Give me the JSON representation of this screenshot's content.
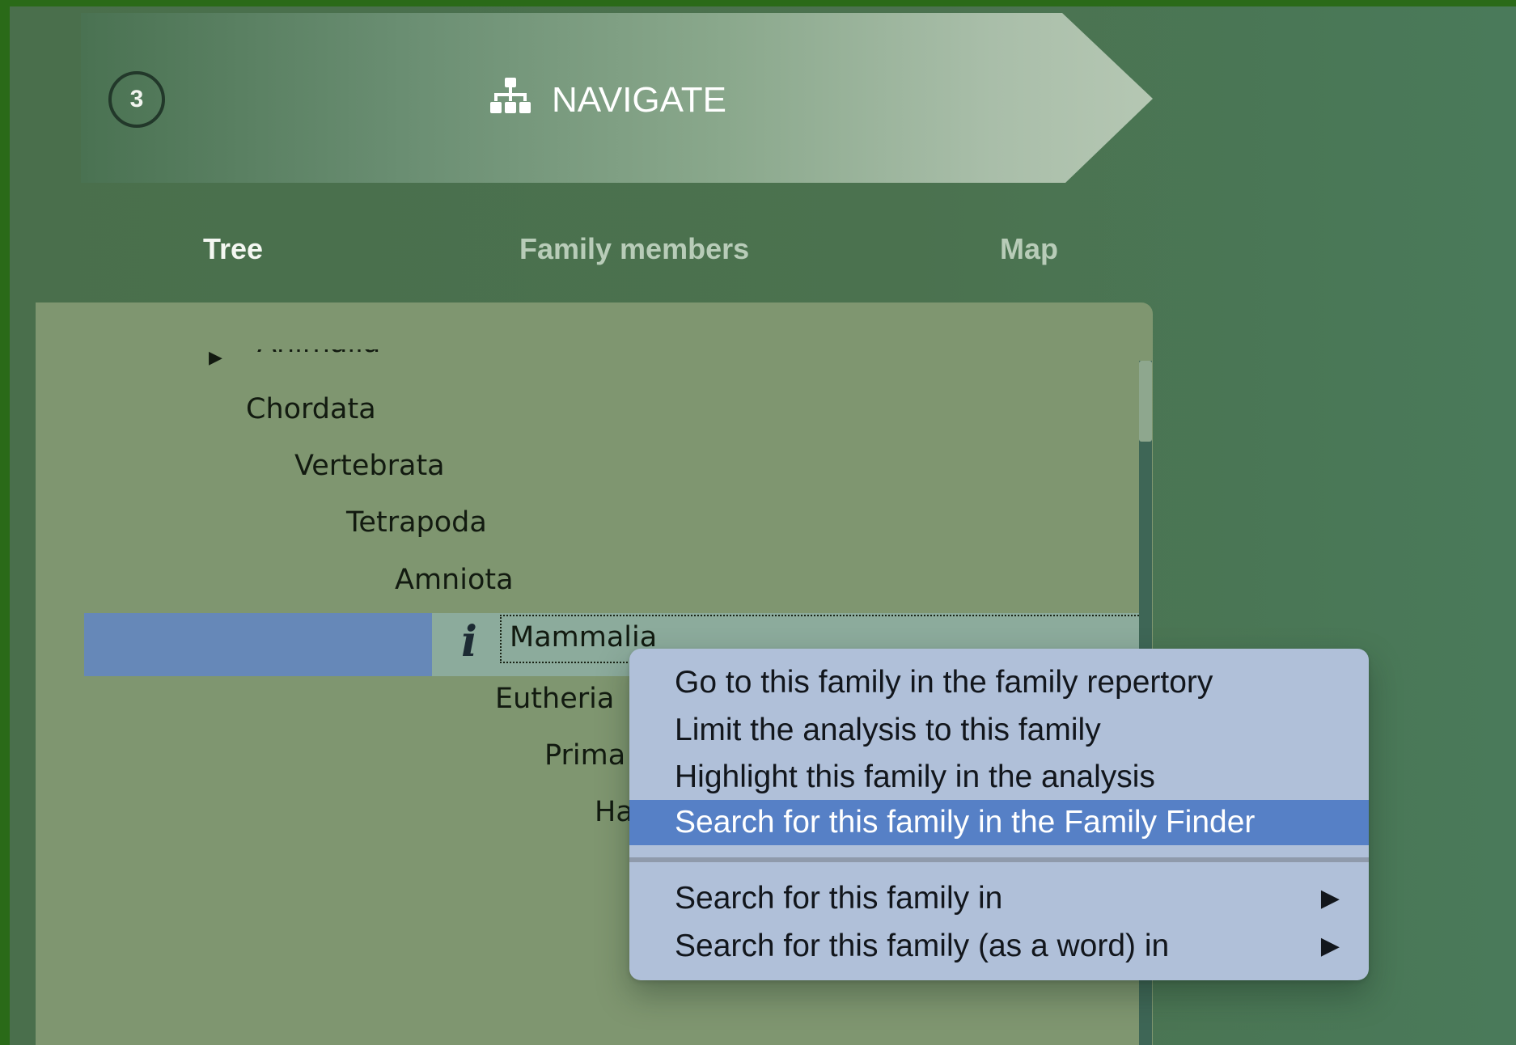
{
  "header": {
    "step_number": "3",
    "title": "NAVIGATE",
    "icon": "sitemap-icon"
  },
  "tabs": [
    {
      "label": "Tree",
      "active": true
    },
    {
      "label": "Family members",
      "active": false
    },
    {
      "label": "Map",
      "active": false
    }
  ],
  "tree": {
    "partial_item": "Animalia",
    "items": [
      {
        "label": "Chordata"
      },
      {
        "label": "Vertebrata"
      },
      {
        "label": "Tetrapoda"
      },
      {
        "label": "Amniota"
      },
      {
        "label": "Mammalia"
      },
      {
        "label": "Eutheria"
      },
      {
        "label": "Prima"
      },
      {
        "label": "Ha"
      }
    ],
    "info_glyph": "i"
  },
  "context_menu": {
    "items": [
      {
        "label": "Go to this family in the family repertory"
      },
      {
        "label": "Limit the analysis to this family"
      },
      {
        "label": "Highlight this family in the analysis"
      },
      {
        "label": "Search for this family in the Family Finder",
        "highlighted": true
      },
      {
        "label": "Search for this family in",
        "submenu": true
      },
      {
        "label": "Search for this family (as a word) in",
        "submenu": true
      }
    ],
    "submenu_glyph": "▶"
  },
  "colors": {
    "selection": "#6688b8",
    "menu_bg": "#b0c0d9",
    "menu_highlight": "#5680c6",
    "panel_bg": "#7f9670",
    "tab_underline": "#5e9a82"
  }
}
